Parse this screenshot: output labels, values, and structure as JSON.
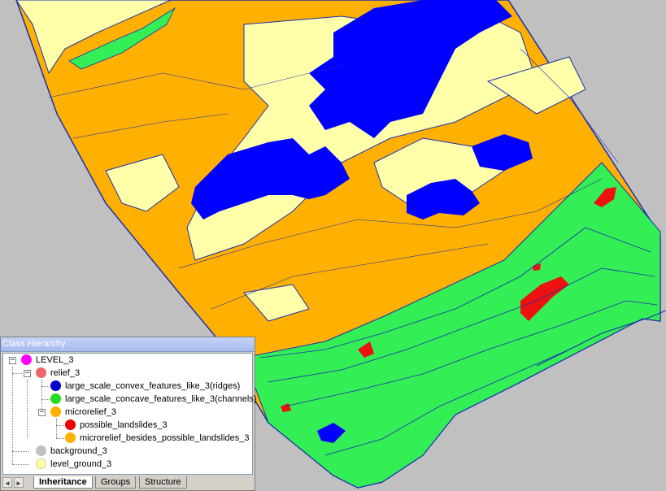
{
  "map": {
    "colors": {
      "background": "#c0c0c0",
      "level_ground": "#ffffaa",
      "microrelief": "#ffb000",
      "ridges": "#0000ff",
      "channels": "#33ee55",
      "landslides": "#ee1111",
      "outline": "#1a2fb0"
    }
  },
  "panel": {
    "title": "Class Hierarchy",
    "tree": [
      {
        "label": "LEVEL_3",
        "color": "#ff00ff",
        "toggle": "−"
      },
      {
        "label": "relief_3",
        "color": "#ee6666",
        "toggle": "−"
      },
      {
        "label": "large_scale_convex_features_like_3(ridges)",
        "color": "#0000cc",
        "toggle": ""
      },
      {
        "label": "large_scale_concave_features_like_3(channels)",
        "color": "#22dd22",
        "toggle": ""
      },
      {
        "label": "microrelief_3",
        "color": "#ffb000",
        "toggle": "−"
      },
      {
        "label": "possible_landslides_3",
        "color": "#ee0000",
        "toggle": ""
      },
      {
        "label": "microrelief_besides_possible_landslides_3",
        "color": "#ffb000",
        "toggle": ""
      },
      {
        "label": "background_3",
        "color": "#c0c0c0",
        "toggle": ""
      },
      {
        "label": "level_ground_3",
        "color": "#ffffaa",
        "toggle": ""
      }
    ],
    "tabs": [
      "Inheritance",
      "Groups",
      "Structure"
    ],
    "nav": {
      "left": "◄",
      "right": "►"
    }
  }
}
